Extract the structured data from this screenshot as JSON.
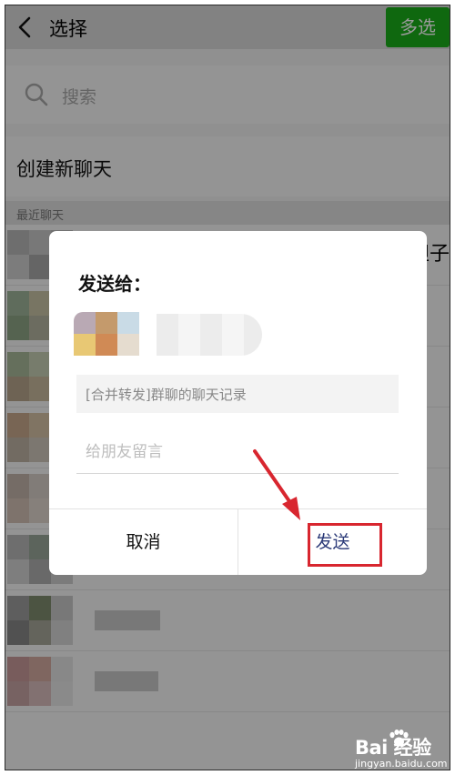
{
  "header": {
    "title": "选择",
    "multi_select_label": "多选"
  },
  "search": {
    "placeholder": "搜索"
  },
  "create_chat": {
    "label": "创建新聊天"
  },
  "recent": {
    "section_label": "最近聊天",
    "partial_name_char": "妲子"
  },
  "dialog": {
    "title": "发送给：",
    "message_preview": "[合并转发]群聊的聊天记录",
    "leave_message_placeholder": "给朋友留言",
    "cancel_label": "取消",
    "send_label": "发送"
  },
  "watermark": {
    "brand": "Bai 经验",
    "url": "jingyan.baidu.com"
  },
  "colors": {
    "accent_green": "#1aad19",
    "send_text": "#2b3a78",
    "annotation_red": "#d8262f"
  },
  "icons": [
    "back-icon",
    "search-icon",
    "paw-icon"
  ]
}
